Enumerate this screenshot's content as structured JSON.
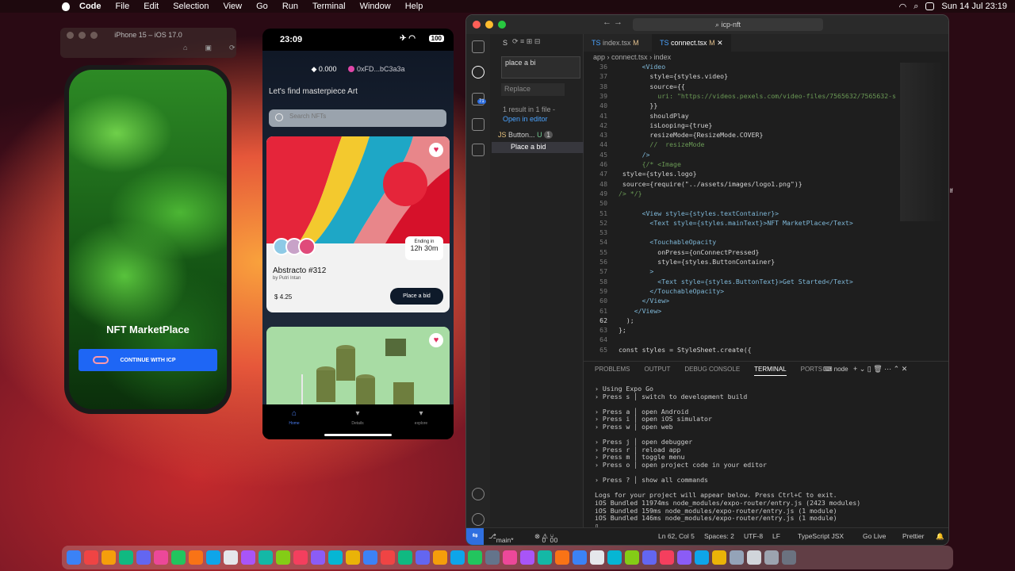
{
  "menubar": {
    "app": "Code",
    "items": [
      "File",
      "Edit",
      "Selection",
      "View",
      "Go",
      "Run",
      "Terminal",
      "Window",
      "Help"
    ],
    "datetime": "Sun 14 Jul  23:19"
  },
  "simulator": {
    "title": "iPhone 15 – iOS 17.0"
  },
  "phone1": {
    "title": "NFT MarketPlace",
    "button": "CONTINUE WITH ICP"
  },
  "phone2": {
    "time": "23:09",
    "battery": "100",
    "balance": "0.000",
    "address": "0xFD...bC3a3a",
    "heading": "Let's find masterpiece Art",
    "search_placeholder": "Search NFTs",
    "card": {
      "ending_label": "Ending in",
      "ending_time": "12h 30m",
      "title": "Abstracto #312",
      "author": "by Putri Intan",
      "price": "4.25",
      "bid_button": "Place a bid"
    },
    "tabs": [
      "Home",
      "Details",
      "explore"
    ]
  },
  "vscode": {
    "search_box": "icp-nft",
    "tab1": "index.tsx",
    "tab1_status": "M",
    "tab2": "connect.tsx",
    "tab2_status": "M",
    "breadcrumb": [
      "app",
      "connect.tsx",
      "index"
    ],
    "side": {
      "search_value": "place a bi",
      "replace_placeholder": "Replace",
      "result": "1 result in 1 file -",
      "open_editor": "Open in editor",
      "file": "Button...",
      "file_status": "U",
      "count": "1",
      "match": "Place a bid",
      "search_letter": "S",
      "badge": "71"
    },
    "code": [
      {
        "n": "36",
        "t": "      <Video"
      },
      {
        "n": "37",
        "t": "        style={styles.video}"
      },
      {
        "n": "38",
        "t": "        source={{"
      },
      {
        "n": "39",
        "t": "          uri: \"https://videos.pexels.com/video-files/7565632/7565632-s"
      },
      {
        "n": "40",
        "t": "        }}"
      },
      {
        "n": "41",
        "t": "        shouldPlay"
      },
      {
        "n": "42",
        "t": "        isLooping={true}"
      },
      {
        "n": "43",
        "t": "        resizeMode={ResizeMode.COVER}"
      },
      {
        "n": "44",
        "t": "        //  resizeMode"
      },
      {
        "n": "45",
        "t": "      />"
      },
      {
        "n": "46",
        "t": "      {/* <Image"
      },
      {
        "n": "47",
        "t": " style={styles.logo}"
      },
      {
        "n": "48",
        "t": " source={require(\"../assets/images/logo1.png\")}"
      },
      {
        "n": "49",
        "t": "/> */}"
      },
      {
        "n": "50",
        "t": ""
      },
      {
        "n": "51",
        "t": "      <View style={styles.textContainer}>"
      },
      {
        "n": "52",
        "t": "        <Text style={styles.mainText}>NFT MarketPlace</Text>"
      },
      {
        "n": "53",
        "t": ""
      },
      {
        "n": "54",
        "t": "        <TouchableOpacity"
      },
      {
        "n": "55",
        "t": "          onPress={onConnectPressed}"
      },
      {
        "n": "56",
        "t": "          style={styles.ButtonContainer}"
      },
      {
        "n": "57",
        "t": "        >"
      },
      {
        "n": "58",
        "t": "          <Text style={styles.ButtonText}>Get Started</Text>"
      },
      {
        "n": "59",
        "t": "        </TouchableOpacity>"
      },
      {
        "n": "60",
        "t": "      </View>"
      },
      {
        "n": "61",
        "t": "    </View>"
      },
      {
        "n": "62",
        "t": "  );"
      },
      {
        "n": "63",
        "t": "};"
      },
      {
        "n": "64",
        "t": ""
      },
      {
        "n": "65",
        "t": "const styles = StyleSheet.create({"
      }
    ],
    "panel_tabs": [
      "PROBLEMS",
      "OUTPUT",
      "DEBUG CONSOLE",
      "TERMINAL",
      "PORTS"
    ],
    "panel_shell": "node",
    "terminal": "› Using Expo Go\n› Press s │ switch to development build\n\n› Press a │ open Android\n› Press i │ open iOS simulator\n› Press w │ open web\n\n› Press j │ open debugger\n› Press r │ reload app\n› Press m │ toggle menu\n› Press o │ open project code in your editor\n\n› Press ? │ show all commands\n\nLogs for your project will appear below. Press Ctrl+C to exit.\niOS Bundled 11974ms node_modules/expo-router/entry.js (2423 modules)\niOS Bundled 159ms node_modules/expo-router/entry.js (1 module)\niOS Bundled 146ms node_modules/expo-router/entry.js (1 module)\n▯",
    "status": {
      "branch": "main*",
      "errors": "0",
      "warnings": "0",
      "ports": "0",
      "position": "Ln 62, Col 5",
      "spaces": "Spaces: 2",
      "encoding": "UTF-8",
      "eol": "LF",
      "lang": "TypeScript JSX",
      "golive": "Go Live",
      "prettier": "Prettier"
    }
  },
  "colors": {
    "accent": "#1e66f5",
    "vscode_bg": "#1e1e1e"
  }
}
